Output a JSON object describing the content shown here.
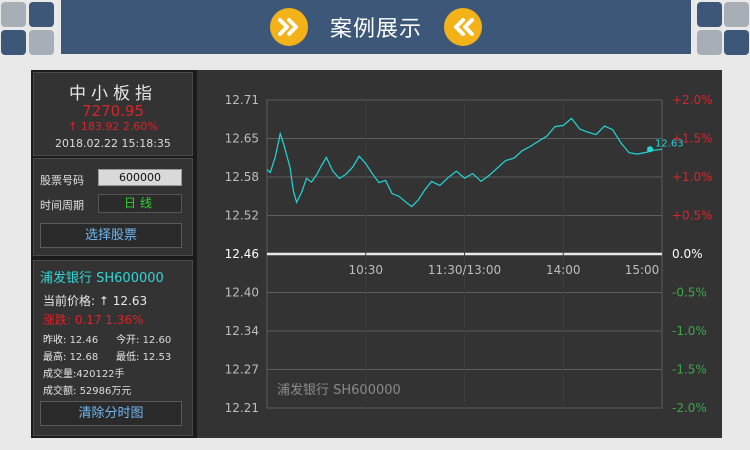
{
  "header": {
    "title": "案例展示",
    "colors": {
      "banner": "#3d5778",
      "accent": "#f3b318",
      "corner_dark": "#3d5778",
      "corner_light": "#a8aeb6"
    }
  },
  "index": {
    "name": "中小板指",
    "value": "7270.95",
    "change": "↑ 183.92  2.60%",
    "datetime": "2018.02.22 15:18:35"
  },
  "controls": {
    "code_label": "股票号码",
    "code_value": "600000",
    "period_label": "时间周期",
    "period_value": "日线",
    "select_button": "选择股票"
  },
  "stock": {
    "name": "浦发银行 SH600000",
    "current_label": "当前价格:",
    "current_arrow": "↑",
    "current_value": "12.63",
    "change_text": "涨跌: 0.17  1.36%",
    "prev_close_label": "昨收:",
    "prev_close": "12.46",
    "open_label": "今开:",
    "open": "12.60",
    "high_label": "最高:",
    "high": "12.68",
    "low_label": "最低:",
    "low": "12.53",
    "volume_label": "成交量:",
    "volume": "420122手",
    "amount_label": "成交额:",
    "amount": "52986万元",
    "clear_button": "清除分时图"
  },
  "chart_data": {
    "type": "line",
    "title": "",
    "watermark": "浦发银行 SH600000",
    "y_ticks": [
      "12.71",
      "12.65",
      "12.58",
      "12.52",
      "12.46",
      "12.40",
      "12.34",
      "12.27",
      "12.21"
    ],
    "y_right_ticks": [
      "+2.0%",
      "+1.5%",
      "+1.0%",
      "+0.5%",
      "0.0%",
      "-0.5%",
      "-1.0%",
      "-1.5%",
      "-2.0%"
    ],
    "x_ticks": [
      "10:30",
      "11:30/13:00",
      "14:00",
      "15:00"
    ],
    "ylim": [
      12.21,
      12.71
    ],
    "base_price": 12.46,
    "last_value_label": "12.63",
    "series": [
      {
        "x": [
          0,
          2,
          5,
          8,
          10,
          12,
          14,
          16,
          18,
          21,
          24,
          27,
          30,
          33,
          36,
          40,
          44,
          48,
          52,
          56,
          60,
          64,
          68,
          72,
          76,
          80,
          84,
          88,
          92,
          96,
          100,
          105,
          110,
          115,
          120,
          125,
          130,
          135,
          140,
          145,
          150,
          155,
          160,
          165,
          170,
          175,
          180,
          185,
          190,
          195,
          200,
          205,
          210,
          215,
          220,
          225,
          230,
          235,
          240
        ],
        "y": [
          12.6,
          12.59,
          12.62,
          12.655,
          12.64,
          12.62,
          12.6,
          12.565,
          12.545,
          12.56,
          12.58,
          12.575,
          12.59,
          12.6,
          12.615,
          12.595,
          12.58,
          12.59,
          12.6,
          12.62,
          12.605,
          12.59,
          12.575,
          12.58,
          12.56,
          12.555,
          12.545,
          12.54,
          12.55,
          12.565,
          12.575,
          12.57,
          12.585,
          12.595,
          12.585,
          12.59,
          12.575,
          12.585,
          12.6,
          12.61,
          12.615,
          12.625,
          12.635,
          12.645,
          12.65,
          12.665,
          12.67,
          12.68,
          12.665,
          12.66,
          12.655,
          12.67,
          12.66,
          12.64,
          12.625,
          12.62,
          12.625,
          12.63,
          12.63
        ]
      }
    ],
    "colors": {
      "line": "#22d8d8",
      "positive": "#d9242b",
      "negative": "#3aa84a",
      "baseline": "#e8e8e8",
      "grid": "#5d5d5d"
    },
    "grid": true
  }
}
